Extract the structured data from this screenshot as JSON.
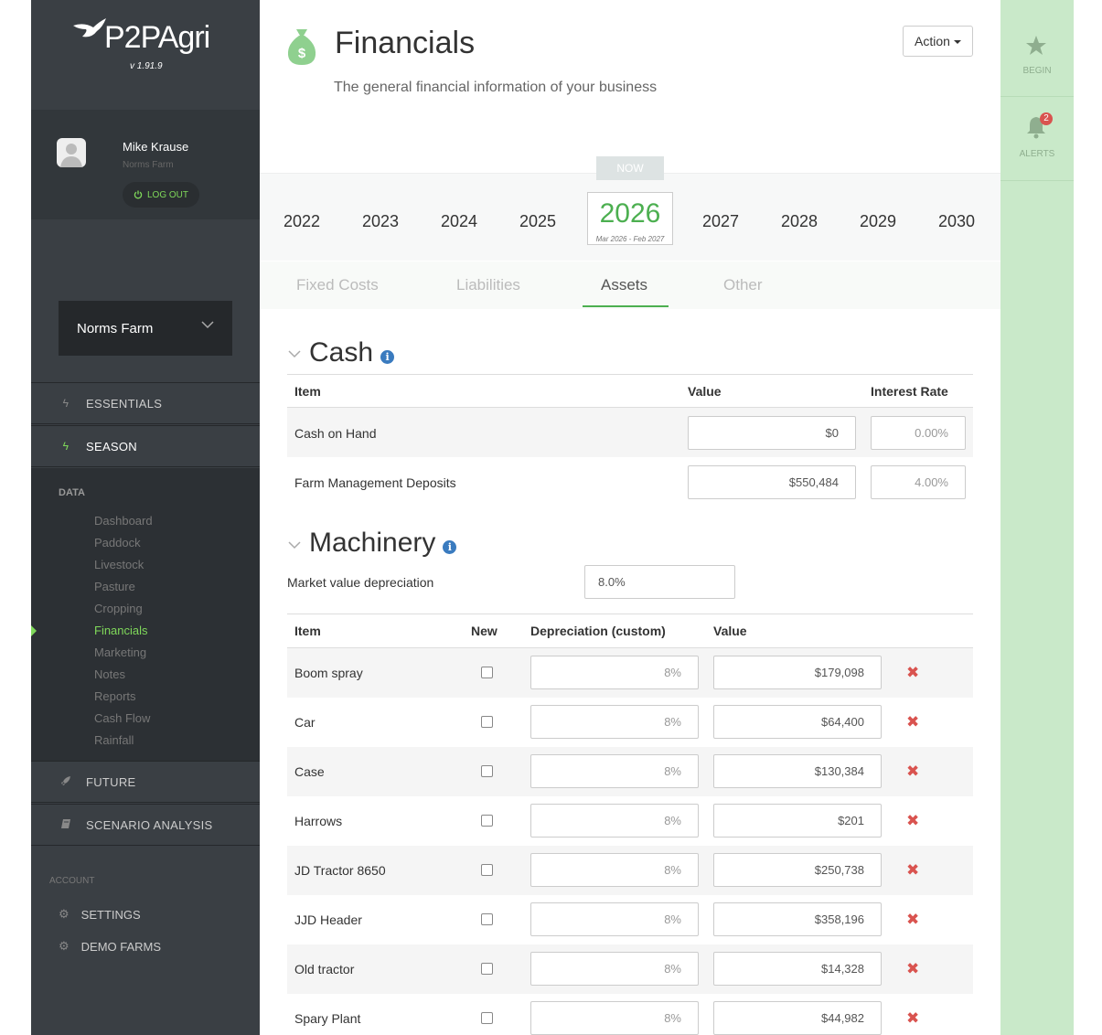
{
  "app": {
    "logo_text": "P2PAgri",
    "version": "v 1.91.9"
  },
  "user": {
    "name": "Mike Krause",
    "farm": "Norms Farm",
    "logout_label": "LOG OUT"
  },
  "farm_selector": {
    "value": "Norms Farm"
  },
  "nav": {
    "essentials": "ESSENTIALS",
    "season": "SEASON",
    "data_label": "DATA",
    "data_items": [
      "Dashboard",
      "Paddock",
      "Livestock",
      "Pasture",
      "Cropping",
      "Financials",
      "Marketing",
      "Notes",
      "Reports",
      "Cash Flow",
      "Rainfall"
    ],
    "active_item": "Financials",
    "future": "FUTURE",
    "scenario": "SCENARIO ANALYSIS",
    "account_label": "ACCOUNT",
    "settings": "SETTINGS",
    "demo_farms": "DEMO FARMS"
  },
  "header": {
    "title": "Financials",
    "subtitle": "The general financial information of your business",
    "action_label": "Action"
  },
  "years": {
    "before": [
      "2022",
      "2023",
      "2024",
      "2025"
    ],
    "current": "2026",
    "current_range": "Mar 2026 - Feb 2027",
    "now_label": "NOW",
    "after": [
      "2027",
      "2028",
      "2029",
      "2030"
    ]
  },
  "tabs": {
    "items": [
      "Fixed Costs",
      "Liabilities",
      "Assets",
      "Other"
    ],
    "active": "Assets"
  },
  "cash": {
    "title": "Cash",
    "headers": {
      "item": "Item",
      "value": "Value",
      "rate": "Interest Rate"
    },
    "rows": [
      {
        "item": "Cash on Hand",
        "value": "$0",
        "rate": "0.00%"
      },
      {
        "item": "Farm Management Deposits",
        "value": "$550,484",
        "rate": "4.00%"
      }
    ]
  },
  "machinery": {
    "title": "Machinery",
    "depreciation_label": "Market value depreciation",
    "depreciation_value": "8.0%",
    "headers": {
      "item": "Item",
      "new": "New",
      "depreciation": "Depreciation (custom)",
      "value": "Value"
    },
    "rows": [
      {
        "item": "Boom spray",
        "depreciation": "8%",
        "value": "$179,098"
      },
      {
        "item": "Car",
        "depreciation": "8%",
        "value": "$64,400"
      },
      {
        "item": "Case",
        "depreciation": "8%",
        "value": "$130,384"
      },
      {
        "item": "Harrows",
        "depreciation": "8%",
        "value": "$201"
      },
      {
        "item": "JD Tractor 8650",
        "depreciation": "8%",
        "value": "$250,738"
      },
      {
        "item": "JJD Header",
        "depreciation": "8%",
        "value": "$358,196"
      },
      {
        "item": "Old tractor",
        "depreciation": "8%",
        "value": "$14,328"
      },
      {
        "item": "Spary Plant",
        "depreciation": "8%",
        "value": "$44,982"
      }
    ]
  },
  "right_panel": {
    "begin_label": "BEGIN",
    "alerts_label": "ALERTS",
    "alerts_count": "2"
  },
  "colors": {
    "accent_green": "#4caf50",
    "sidebar_bg": "#3a3f44",
    "right_panel_bg": "#c9e9c9",
    "delete_red": "#d9534f",
    "info_blue": "#3a7bbf"
  }
}
